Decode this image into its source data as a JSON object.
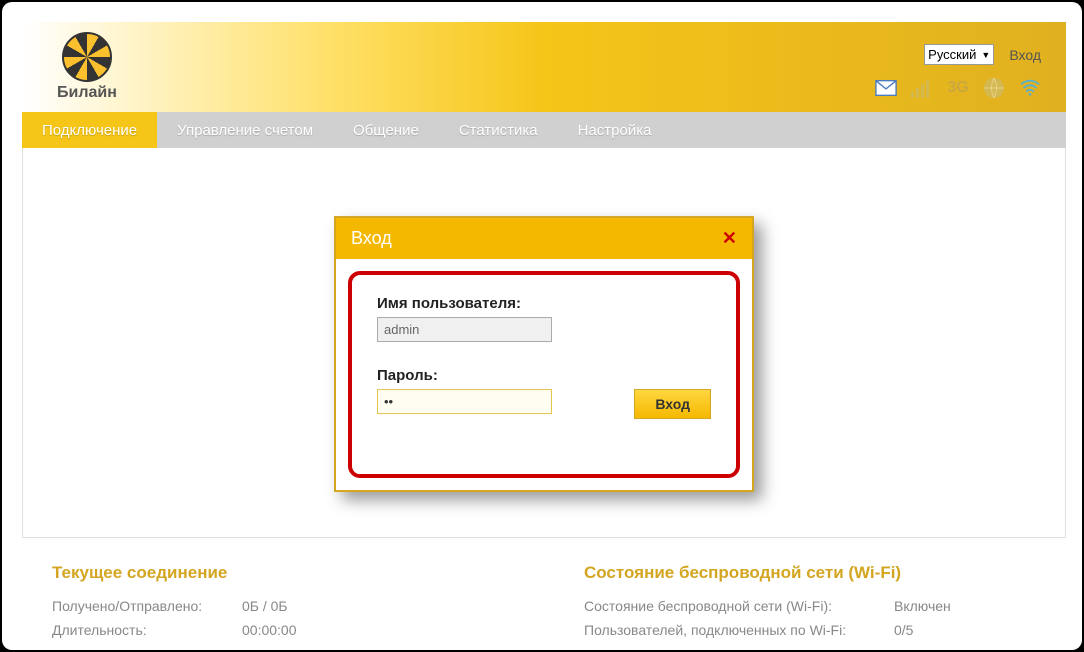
{
  "brand": "Билайн",
  "topbar": {
    "language": "Русский",
    "login_link": "Вход"
  },
  "nav": {
    "items": [
      {
        "label": "Подключение",
        "active": true
      },
      {
        "label": "Управление счетом",
        "active": false
      },
      {
        "label": "Общение",
        "active": false
      },
      {
        "label": "Статистика",
        "active": false
      },
      {
        "label": "Настройка",
        "active": false
      }
    ]
  },
  "dialog": {
    "title": "Вход",
    "username_label": "Имя пользователя:",
    "username_value": "admin",
    "password_label": "Пароль:",
    "password_value": "••",
    "submit": "Вход"
  },
  "status": {
    "left": {
      "title": "Текущее соединение",
      "rows": [
        {
          "label": "Получено/Отправлено:",
          "value": "0Б / 0Б"
        },
        {
          "label": "Длительность:",
          "value": "00:00:00"
        }
      ]
    },
    "right": {
      "title": "Состояние беспроводной сети (Wi-Fi)",
      "rows": [
        {
          "label": "Состояние беспроводной сети (Wi-Fi):",
          "value": "Включен"
        },
        {
          "label": "Пользователей, подключенных по Wi-Fi:",
          "value": "0/5"
        }
      ]
    }
  }
}
